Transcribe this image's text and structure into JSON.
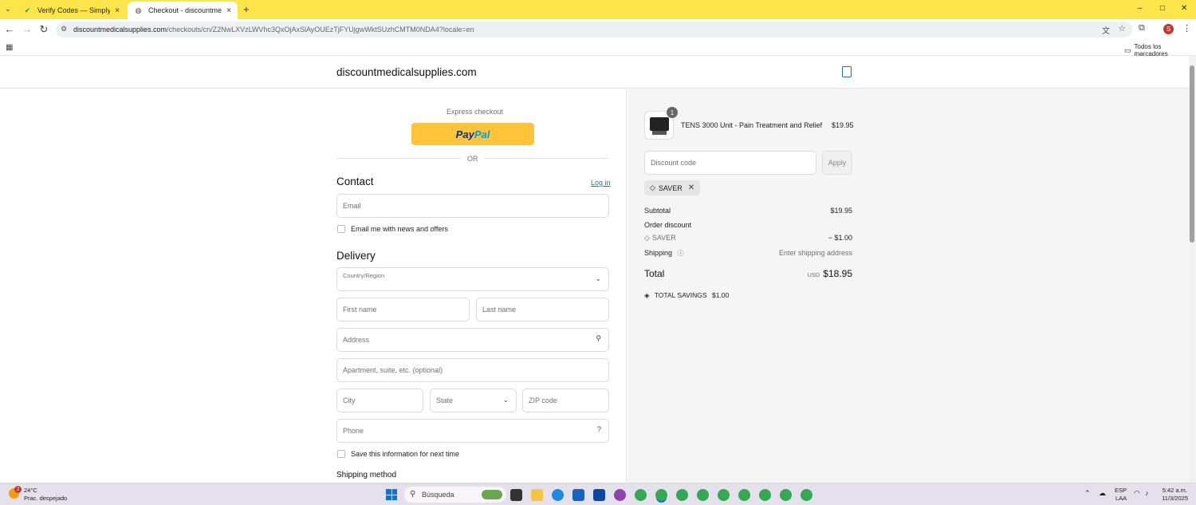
{
  "browser": {
    "tabs": [
      {
        "title": "Verify Codes — SimplyCodes",
        "close": "×"
      },
      {
        "title": "Checkout - discountmedicalsu",
        "close": "×"
      }
    ],
    "new_tab": "+",
    "url_host": "discountmedicalsupplies.com",
    "url_path": "/checkouts/cn/Z2NwLXVzLWVhc3QxOjAxSlAyOUEzTjFYUjgwWktSUzhCMTM0NDA4?locale=en",
    "bookmarks_label": "Todos los marcadores",
    "profile_initial": "S",
    "window_controls": [
      "–",
      "□",
      "✕"
    ]
  },
  "store": {
    "name": "discountmedicalsupplies.com"
  },
  "checkout": {
    "express_label": "Express checkout",
    "paypal_pay": "Pay",
    "paypal_pal": "Pal",
    "or_label": "OR",
    "contact_heading": "Contact",
    "login_link": "Log in",
    "email_placeholder": "Email",
    "news_checkbox_label": "Email me with news and offers",
    "delivery_heading": "Delivery",
    "country_label": "Country/Region",
    "first_name_placeholder": "First name",
    "last_name_placeholder": "Last name",
    "address_placeholder": "Address",
    "apartment_placeholder": "Apartment, suite, etc. (optional)",
    "city_placeholder": "City",
    "state_placeholder": "State",
    "zip_placeholder": "ZIP code",
    "phone_placeholder": "Phone",
    "save_info_label": "Save this information for next time",
    "shipping_method_heading": "Shipping method"
  },
  "summary": {
    "product_name": "TENS 3000 Unit - Pain Treatment and Relief",
    "product_price": "$19.95",
    "product_qty": "1",
    "discount_placeholder": "Discount code",
    "apply_label": "Apply",
    "applied_code": "SAVER",
    "subtotal_label": "Subtotal",
    "subtotal_value": "$19.95",
    "order_discount_label": "Order discount",
    "discount_code": "SAVER",
    "discount_value": "− $1.00",
    "shipping_label": "Shipping",
    "shipping_value": "Enter shipping address",
    "total_label": "Total",
    "total_currency": "USD",
    "total_value": "$18.95",
    "savings_label": "TOTAL SAVINGS",
    "savings_value": "$1.00"
  },
  "taskbar": {
    "weather_temp": "24°C",
    "weather_desc": "Prac. despejado",
    "weather_badge": "2",
    "search_placeholder": "Búsqueda",
    "lang_top": "ESP",
    "lang_bottom": "LAA",
    "time": "5:42 a.m.",
    "date": "11/3/2025"
  },
  "colors": {
    "tab_bar": "#fbe54a",
    "paypal_yellow": "#ffc439",
    "link_blue": "#1773b0",
    "summary_bg": "#f5f5f5"
  }
}
